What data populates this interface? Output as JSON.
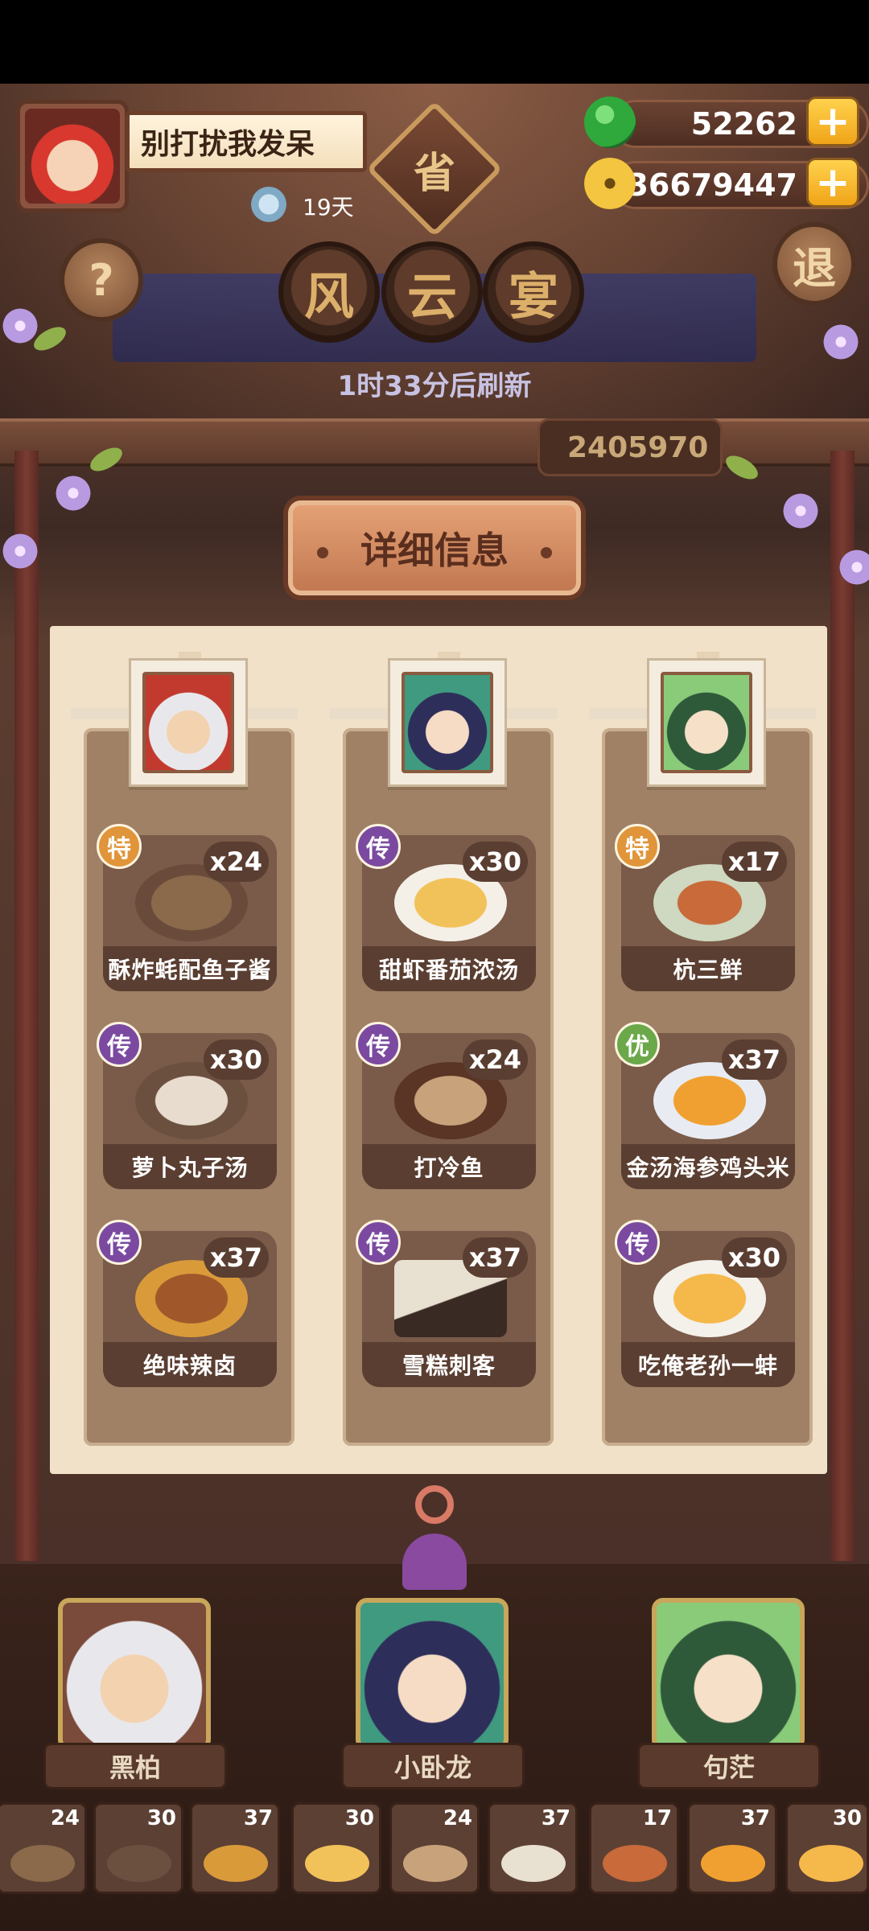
{
  "profile": {
    "player_name": "别打扰我发呆",
    "days": "19天"
  },
  "province_badge": "省",
  "currency": {
    "jade": "52262",
    "coins": "36679447",
    "plus_label": "+"
  },
  "buttons": {
    "help": "?",
    "exit": "退"
  },
  "event_title": [
    "风",
    "云",
    "宴"
  ],
  "refresh_text": "1时33分后刷新",
  "score_partial": "2405970",
  "detail_tab": "详细信息",
  "colors": {
    "grade_te": "#e0953a",
    "grade_chuan": "#7b4aa0",
    "grade_you": "#6aa84a",
    "panel": "#f1e1c8",
    "accent_gold": "#f0a418"
  },
  "columns": [
    {
      "chef": "黑柏",
      "dishes": [
        {
          "name": "酥炸蚝配鱼子酱",
          "grade": "特",
          "count": "x24",
          "plate_color": "#8a6a4a"
        },
        {
          "name": "萝卜丸子汤",
          "grade": "传",
          "count": "x30",
          "plate_color": "#6b5040"
        },
        {
          "name": "绝味辣卤",
          "grade": "传",
          "count": "x37",
          "plate_color": "#d99a3a"
        }
      ]
    },
    {
      "chef": "小卧龙",
      "dishes": [
        {
          "name": "甜虾番茄浓汤",
          "grade": "传",
          "count": "x30",
          "plate_color": "#f2c25a"
        },
        {
          "name": "打冷鱼",
          "grade": "传",
          "count": "x24",
          "plate_color": "#c8a27a"
        },
        {
          "name": "雪糕刺客",
          "grade": "传",
          "count": "x37",
          "plate_color": "#e8e0d0"
        }
      ]
    },
    {
      "chef": "句茫",
      "dishes": [
        {
          "name": "杭三鲜",
          "grade": "特",
          "count": "x17",
          "plate_color": "#c86a3a"
        },
        {
          "name": "金汤海参鸡头米",
          "grade": "优",
          "count": "x37",
          "plate_color": "#f0a030"
        },
        {
          "name": "吃俺老孙一蚌",
          "grade": "传",
          "count": "x30",
          "plate_color": "#f5b84a"
        }
      ]
    }
  ],
  "tray": [
    {
      "count": "24",
      "plate_color": "#8a6a4a"
    },
    {
      "count": "30",
      "plate_color": "#6b5040"
    },
    {
      "count": "37",
      "plate_color": "#d99a3a"
    },
    {
      "count": "30",
      "plate_color": "#f2c25a"
    },
    {
      "count": "24",
      "plate_color": "#c8a27a"
    },
    {
      "count": "37",
      "plate_color": "#e8e0d0"
    },
    {
      "count": "17",
      "plate_color": "#c86a3a"
    },
    {
      "count": "37",
      "plate_color": "#f0a030"
    },
    {
      "count": "30",
      "plate_color": "#f5b84a"
    }
  ]
}
